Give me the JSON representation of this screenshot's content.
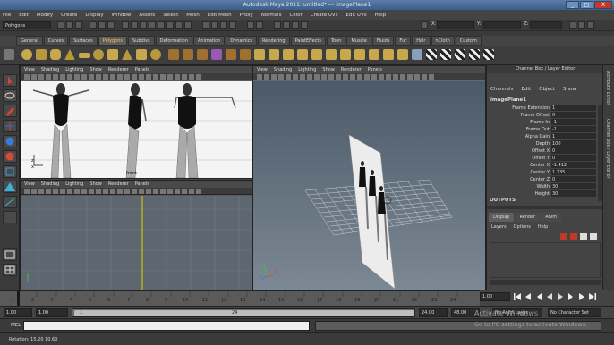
{
  "window": {
    "title": "Autodesk Maya 2011: untitled*   ---   imagePlane1",
    "min": "_",
    "max": "□",
    "close": "X"
  },
  "menubar": [
    "File",
    "Edit",
    "Modify",
    "Create",
    "Display",
    "Window",
    "Assets",
    "Select",
    "Mesh",
    "Edit Mesh",
    "Proxy",
    "Normals",
    "Color",
    "Create UVs",
    "Edit UVs",
    "Help"
  ],
  "status": {
    "mode": "Polygons",
    "x_label": "X:",
    "y_label": "Y:",
    "z_label": "Z:"
  },
  "shelf_tabs": [
    "General",
    "Curves",
    "Surfaces",
    "Polygons",
    "Subdivs",
    "Deformation",
    "Animation",
    "Dynamics",
    "Rendering",
    "PaintEffects",
    "Toon",
    "Muscle",
    "Fluids",
    "Fur",
    "Hair",
    "nCloth",
    "Custom"
  ],
  "shelf_active": "Polygons",
  "panel_menu": [
    "View",
    "Shading",
    "Lighting",
    "Show",
    "Renderer",
    "Panels"
  ],
  "front_panel": {
    "axis_x": "x",
    "axis_z": "z",
    "cam_label": "front"
  },
  "persp_panel": {
    "axis_x": "x",
    "axis_y": "y",
    "axis_z": "z"
  },
  "channel_box": {
    "header": "Channel Box / Layer Editor",
    "menus": [
      "Channels",
      "Edit",
      "Object",
      "Show"
    ],
    "node": "imagePlane1",
    "attributes": [
      {
        "name": "Frame Extension",
        "value": "1"
      },
      {
        "name": "Frame Offset",
        "value": "0"
      },
      {
        "name": "Frame In",
        "value": "-1"
      },
      {
        "name": "Frame Out",
        "value": "-1"
      },
      {
        "name": "Alpha Gain",
        "value": "1"
      },
      {
        "name": "Depth",
        "value": "100"
      },
      {
        "name": "Offset X",
        "value": "0"
      },
      {
        "name": "Offset Y",
        "value": "0"
      },
      {
        "name": "Center X",
        "value": "-1.412"
      },
      {
        "name": "Center Y",
        "value": "1.235"
      },
      {
        "name": "Center Z",
        "value": "0"
      },
      {
        "name": "Width",
        "value": "30"
      },
      {
        "name": "Height",
        "value": "30"
      }
    ],
    "outputs": "OUTPUTS",
    "layer_tabs": [
      "Display",
      "Render",
      "Anim"
    ],
    "layer_menus": [
      "Layers",
      "Options",
      "Help"
    ]
  },
  "side_tabs": [
    "Attribute Editor",
    "Channel Box / Layer Editor"
  ],
  "time_ticks": [
    "1",
    "2",
    "3",
    "4",
    "5",
    "6",
    "7",
    "8",
    "9",
    "10",
    "11",
    "12",
    "13",
    "14",
    "15",
    "16",
    "17",
    "18",
    "19",
    "20",
    "21",
    "22",
    "23",
    "24"
  ],
  "current_frame": "1.00",
  "range": {
    "start": "1.00",
    "inner_start": "1.00",
    "slider_start": "1",
    "slider_end": "24",
    "end": "24.00",
    "anim_end": "48.00",
    "anim_layer": "No Anim Layer",
    "char_set": "No Character Set"
  },
  "cmd_label": "MEL",
  "help_text": "Rotation:   15.20   10.60",
  "watermark": {
    "line1": "Activate Windows",
    "line2": "Go to PC settings to activate Windows."
  }
}
